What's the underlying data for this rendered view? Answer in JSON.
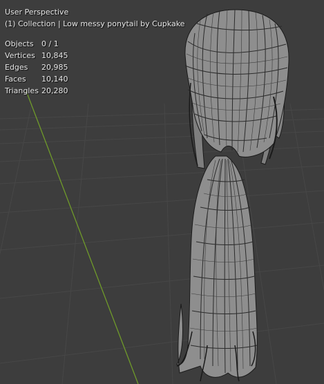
{
  "viewport": {
    "view_name": "User Perspective",
    "collection_info": "(1) Collection | Low messy ponytail by Cupkake",
    "stats": [
      {
        "label": "Objects",
        "value": "0 / 1"
      },
      {
        "label": "Vertices",
        "value": "10,845"
      },
      {
        "label": "Edges",
        "value": "20,985"
      },
      {
        "label": "Faces",
        "value": "10,140"
      },
      {
        "label": "Triangles",
        "value": "20,280"
      }
    ]
  },
  "colors": {
    "background": "#3d3d3d",
    "grid": "#484848",
    "y_axis": "#6f9a2a",
    "mesh_fill": "#8e8e8e",
    "wire": "#1a1a1a"
  }
}
